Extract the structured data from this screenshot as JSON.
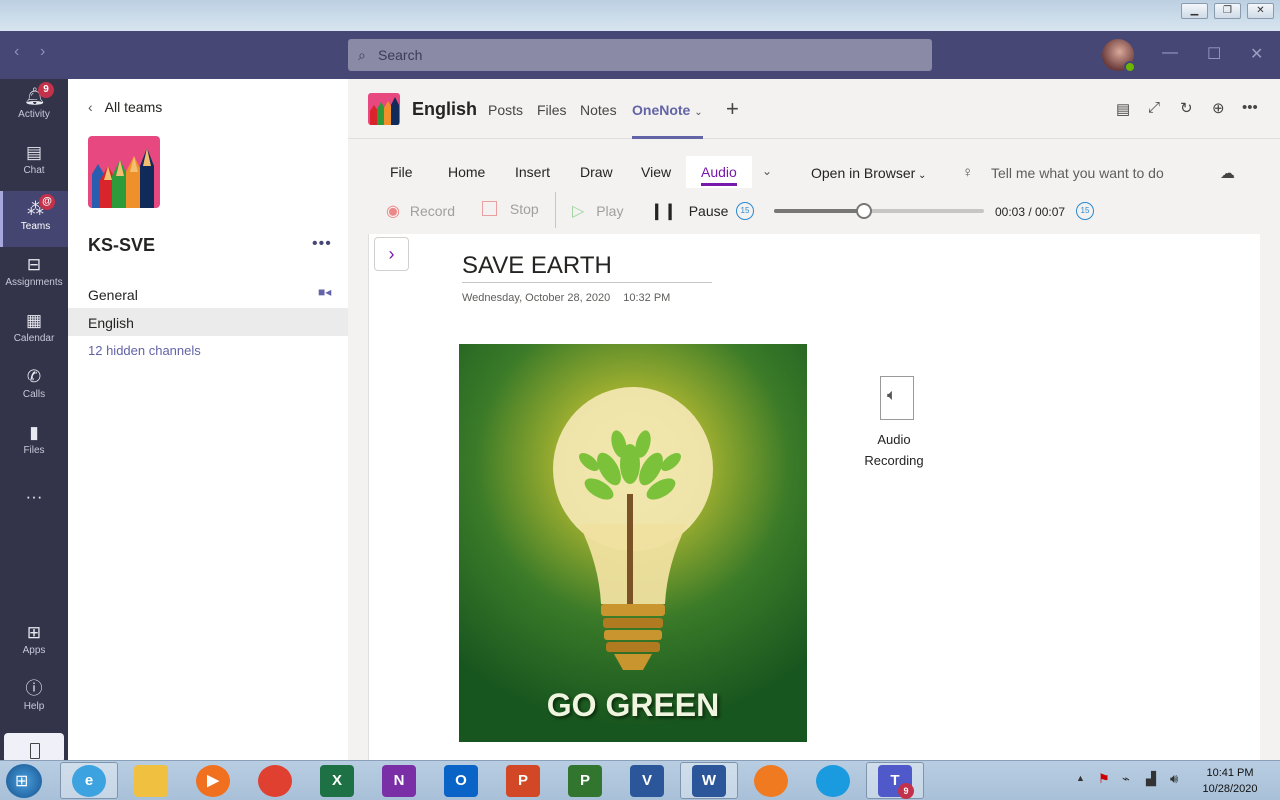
{
  "window": {
    "search_placeholder": "Search",
    "back_icon": "chevron-left-icon",
    "forward_icon": "chevron-right-icon"
  },
  "rail": {
    "items": [
      {
        "label": "Activity",
        "icon": "bell-icon",
        "badge": "9"
      },
      {
        "label": "Chat",
        "icon": "chat-icon"
      },
      {
        "label": "Teams",
        "icon": "teams-icon",
        "badge": "@"
      },
      {
        "label": "Assignments",
        "icon": "backpack-icon"
      },
      {
        "label": "Calendar",
        "icon": "calendar-icon"
      },
      {
        "label": "Calls",
        "icon": "phone-icon"
      },
      {
        "label": "Files",
        "icon": "file-icon"
      },
      {
        "label": "Apps",
        "icon": "apps-icon"
      },
      {
        "label": "Help",
        "icon": "help-icon"
      }
    ]
  },
  "teams_panel": {
    "back_label": "All teams",
    "team_name": "KS-SVE",
    "channels": [
      {
        "name": "General"
      },
      {
        "name": "English",
        "selected": true
      }
    ],
    "hidden_channels": "12 hidden channels"
  },
  "channel_header": {
    "title": "English",
    "tabs": [
      "Posts",
      "Files",
      "Notes",
      "OneNote"
    ],
    "active_tab": "OneNote"
  },
  "ribbon": {
    "tabs": [
      "File",
      "Home",
      "Insert",
      "Draw",
      "View",
      "Audio"
    ],
    "active_tab": "Audio",
    "open_in_browser": "Open in Browser",
    "tell_me": "Tell me what you want to do"
  },
  "audio_bar": {
    "record": "Record",
    "stop": "Stop",
    "play": "Play",
    "pause": "Pause",
    "rewind": "15",
    "forward": "15",
    "time": "00:03 / 00:07",
    "progress_fraction": 0.43
  },
  "page": {
    "title": "SAVE EARTH",
    "date": "Wednesday, October 28, 2020",
    "time": "10:32 PM",
    "image_caption": "GO GREEN",
    "attachment_label_line1": "Audio",
    "attachment_label_line2": "Recording"
  },
  "taskbar": {
    "apps": [
      {
        "name": "internet-explorer",
        "letter": "e",
        "color": "#3ca3e0"
      },
      {
        "name": "file-explorer",
        "letter": "",
        "color": "#f0c040"
      },
      {
        "name": "media-player",
        "letter": "▶",
        "color": "#f07020"
      },
      {
        "name": "chrome",
        "letter": "",
        "color": "#e04030"
      },
      {
        "name": "excel",
        "letter": "X",
        "color": "#1e7145"
      },
      {
        "name": "onenote",
        "letter": "N",
        "color": "#7b2fa6"
      },
      {
        "name": "outlook",
        "letter": "O",
        "color": "#0a64c8"
      },
      {
        "name": "powerpoint",
        "letter": "P",
        "color": "#d24726"
      },
      {
        "name": "project",
        "letter": "P",
        "color": "#31752f"
      },
      {
        "name": "visio",
        "letter": "V",
        "color": "#2b579a"
      },
      {
        "name": "word",
        "letter": "W",
        "color": "#2b579a"
      },
      {
        "name": "firefox",
        "letter": "",
        "color": "#f07a20"
      },
      {
        "name": "edge",
        "letter": "",
        "color": "#1a9adf"
      },
      {
        "name": "teams",
        "letter": "T",
        "color": "#5059c9",
        "badge": "9"
      }
    ],
    "clock_time": "10:41 PM",
    "clock_date": "10/28/2020"
  }
}
